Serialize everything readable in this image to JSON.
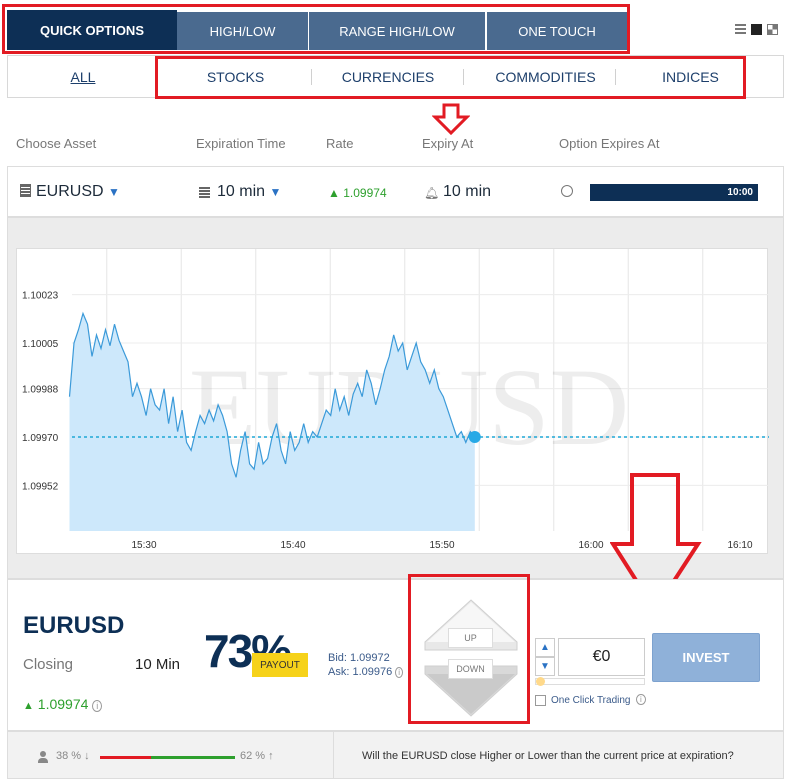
{
  "tabs": [
    {
      "label": "QUICK OPTIONS",
      "active": true
    },
    {
      "label": "HIGH/LOW"
    },
    {
      "label": "RANGE HIGH/LOW"
    },
    {
      "label": "ONE TOUCH"
    }
  ],
  "filters": [
    {
      "label": "ALL",
      "active": true
    },
    {
      "label": "STOCKS"
    },
    {
      "label": "CURRENCIES"
    },
    {
      "label": "COMMODITIES"
    },
    {
      "label": "INDICES"
    }
  ],
  "columns": {
    "choose_asset": "Choose Asset",
    "expiration_time": "Expiration Time",
    "rate": "Rate",
    "expiry_at": "Expiry At",
    "option_expires_at": "Option Expires At"
  },
  "asset_row": {
    "asset": "EURUSD",
    "expiration": "10 min",
    "rate": "1.09974",
    "expiry": "10 min",
    "progress_label": "10:00",
    "progress_fraction": 1.0
  },
  "chart_data": {
    "type": "area",
    "watermark": "EURUSD",
    "y_ticks": [
      "1.10023",
      "1.10005",
      "1.09988",
      "1.09970",
      "1.09952"
    ],
    "x_ticks": [
      "15:30",
      "15:40",
      "15:50",
      "16:00",
      "16:10"
    ],
    "ylim": [
      1.09935,
      1.1004
    ],
    "current_price": 1.0997,
    "x_start_min": 25.0,
    "x_end_min": 70.0,
    "series_end_min": 52.2,
    "y": [
      1.09985,
      1.10005,
      1.1001,
      1.10016,
      1.10012,
      1.1,
      1.10008,
      1.10003,
      1.1001,
      1.10004,
      1.10012,
      1.10006,
      1.10002,
      1.09998,
      1.09985,
      1.0999,
      1.09985,
      1.09978,
      1.09988,
      1.09982,
      1.0998,
      1.09988,
      1.09975,
      1.09985,
      1.09972,
      1.0998,
      1.09968,
      1.09965,
      1.09972,
      1.09978,
      1.09975,
      1.0998,
      1.09976,
      1.09982,
      1.09978,
      1.09972,
      1.0996,
      1.09955,
      1.09965,
      1.09972,
      1.0996,
      1.09958,
      1.09968,
      1.0996,
      1.09962,
      1.0997,
      1.09975,
      1.09965,
      1.0996,
      1.09972,
      1.09965,
      1.09968,
      1.09975,
      1.09968,
      1.09972,
      1.0997,
      1.09975,
      1.0998,
      1.09978,
      1.09988,
      1.0998,
      1.09985,
      1.09978,
      1.09986,
      1.0999,
      1.09985,
      1.09995,
      1.0999,
      1.09982,
      1.09988,
      1.09995,
      1.1,
      1.10008,
      1.10002,
      1.10005,
      1.09995,
      1.1,
      1.10005,
      1.09998,
      1.09995,
      1.0999,
      1.09995,
      1.09988,
      1.09985,
      1.0998,
      1.09975,
      1.0997,
      1.09972,
      1.09968,
      1.09972,
      1.0997
    ]
  },
  "bottom": {
    "asset": "EURUSD",
    "closing_label": "Closing",
    "closing_value": "10 Min",
    "price": "1.09974",
    "payout_pct": "73%",
    "payout_label": "PAYOUT",
    "bid": "Bid: 1.09972",
    "ask": "Ask: 1.09976",
    "up_label": "UP",
    "down_label": "DOWN",
    "amount": "€0",
    "invest_label": "INVEST",
    "one_click_label": "One Click Trading"
  },
  "footer": {
    "left_pct": "38 %",
    "right_pct": "62 %",
    "sentiment_fraction": 0.38,
    "question": "Will the EURUSD close Higher or Lower than the current price at expiration?"
  },
  "colors": {
    "navy": "#0d2f55",
    "tab": "#4a6a8f",
    "red_highlight": "#e21b23",
    "green": "#2ea02e",
    "chart_line": "#3b9ad9",
    "chart_fill": "#cde8fb",
    "payout_yellow": "#f6d21a"
  }
}
